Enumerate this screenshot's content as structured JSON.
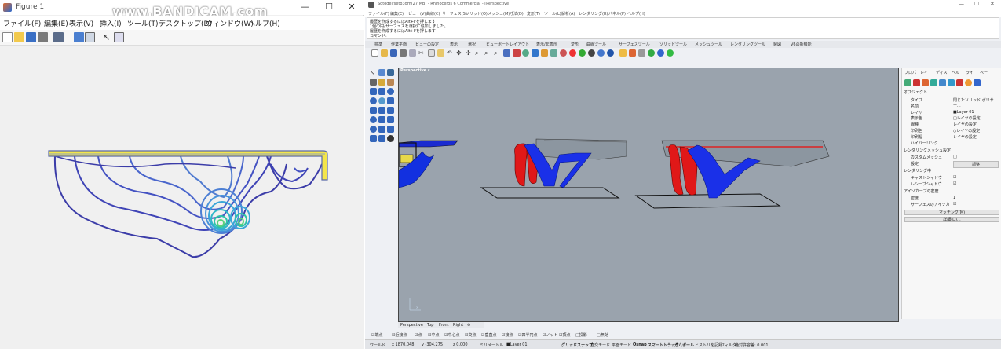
{
  "watermark": "www.BANDICAM.com",
  "figure": {
    "title": "Figure 1",
    "menu": [
      "ファイル(F)",
      "編集(E)",
      "表示(V)",
      "挿入(I)",
      "ツール(T)",
      "デスクトップ(D)",
      "ウィンドウ(W)",
      "ヘルプ(H)"
    ]
  },
  "rhino": {
    "title": "Sotogelfsetb3dm(27 MB) - Rhinoceros 6 Commercial - [Perspective]",
    "menu": [
      "ファイル(F)",
      "編集(E)",
      "ビュー(V)",
      "曲線(C)",
      "サーフェス(S)",
      "ソリッド(O)",
      "メッシュ(M)",
      "寸法(D)",
      "変形(T)",
      "ツール(L)",
      "解析(A)",
      "レンダリング(R)",
      "パネル(P)",
      "ヘルプ(H)"
    ],
    "command_history": [
      "履歴を作成するにはAlt+Fを押します",
      "1個の円/サーフェスを選択に追加しました。",
      "履歴を作成するにはAlt+Fを押します",
      "コマンド:"
    ],
    "toolbar_tabs": [
      "標準",
      "作業平面",
      "ビューの設定",
      "表示",
      "選択",
      "ビューポートレイアウト",
      "表示/非表示",
      "変形",
      "曲線ツール",
      "サーフェスツール",
      "ソリッドツール",
      "メッシュツール",
      "レンダリングツール",
      "製図",
      "V6の新機能"
    ],
    "viewport_label": "Perspective ▾",
    "viewport_tabs": [
      "Perspective",
      "Top",
      "Front",
      "Right",
      "⊕"
    ],
    "osnaps": [
      "☑端点",
      "☑近接点",
      "☑点",
      "☑中点",
      "☑中心点",
      "☑交点",
      "☑垂直点",
      "☑接点",
      "☑四半円点",
      "☑ノット",
      "☑頂点",
      "□投影",
      "□無効"
    ],
    "status": [
      "ワールド",
      "x 1870.048",
      "y -304.275",
      "z 0.000",
      "ミリメートル",
      "■Layer 01",
      "グリッドスナップ",
      "直交モード",
      "平面モード",
      "Osnap",
      "スマートトラック",
      "ガムボール",
      "ヒストリを記録",
      "フィルタ",
      "絶対許容差: 0.001"
    ],
    "panel_tabs": [
      "プロパ",
      "レイ",
      "ディス",
      "ヘル",
      "ライ",
      "ペー"
    ],
    "properties": {
      "section": "オブジェクト",
      "rows": [
        {
          "k": "タイプ",
          "v": "閉じたソリッド ポリサー..."
        },
        {
          "k": "名前",
          "v": ""
        },
        {
          "k": "レイヤ",
          "v": "■Layer 01"
        },
        {
          "k": "表示色",
          "v": "□レイヤの設定"
        },
        {
          "k": "線種",
          "v": "レイヤの設定"
        },
        {
          "k": "印刷色",
          "v": "○レイヤの設定"
        },
        {
          "k": "印刷幅",
          "v": "レイヤの設定"
        },
        {
          "k": "ハイパーリンク",
          "v": ""
        }
      ],
      "mesh_section": "レンダリングメッシュ設定",
      "mesh_rows": [
        {
          "k": "カスタムメッシュ",
          "v": "□"
        },
        {
          "k": "設定",
          "v": "調整"
        }
      ],
      "render_section": "レンダリング中",
      "render_rows": [
        {
          "k": "キャストシャドウ",
          "v": "☑"
        },
        {
          "k": "レシーブシャドウ",
          "v": "☑"
        }
      ],
      "iso_section": "アイソカーブの密度",
      "iso_rows": [
        {
          "k": "密度",
          "v": "1"
        },
        {
          "k": "サーフェスのアイソカ",
          "v": "☑"
        }
      ],
      "buttons": [
        "マッチング(M)",
        "詳細(D)..."
      ]
    }
  }
}
